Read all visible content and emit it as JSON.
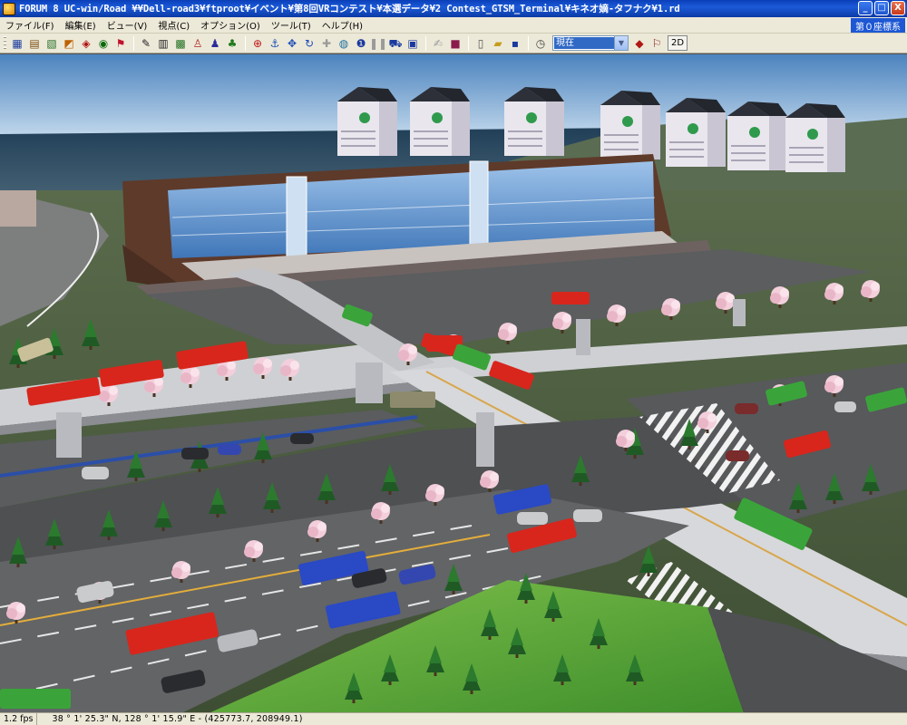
{
  "window": {
    "title": "FORUM 8   UC-win/Road   ¥¥Dell-road3¥ftproot¥イベント¥第8回VRコンテスト¥本選データ¥2 Contest_GTSM_Terminal¥キネオ嫡-タフナク¥1.rd",
    "minimize_label": "_",
    "maximize_label": "□",
    "close_label": "X"
  },
  "menu": {
    "items": [
      "ファイル(F)",
      "編集(E)",
      "ビュー(V)",
      "視点(C)",
      "オプション(O)",
      "ツール(T)",
      "ヘルプ(H)"
    ],
    "coordinate_system": "第０座標系"
  },
  "toolbar": {
    "groups": [
      [
        "toolbar-project-icon",
        "toolbar-road-icon",
        "toolbar-map-icon",
        "toolbar-vehicle-icon",
        "toolbar-sign-icon",
        "toolbar-traffic-icon",
        "toolbar-flag-icon"
      ],
      [
        "toolbar-pen-icon",
        "toolbar-grid-icon",
        "toolbar-model-icon",
        "toolbar-person-icon",
        "toolbar-walker-icon",
        "toolbar-tree-icon"
      ],
      [
        "toolbar-target-icon",
        "toolbar-anchor-icon",
        "toolbar-move-icon",
        "toolbar-rotate-icon",
        "toolbar-plus-icon",
        "toolbar-globe-icon",
        "toolbar-info-icon",
        "toolbar-pause-icon",
        "toolbar-car-icon",
        "toolbar-screen-icon"
      ],
      [
        "toolbar-edit-icon",
        "toolbar-book-icon"
      ],
      [
        "toolbar-new-file-icon",
        "toolbar-open-folder-icon",
        "toolbar-save-icon"
      ]
    ],
    "time_of_day": "現在",
    "view_2d_label": "2D"
  },
  "status": {
    "fps": "1.2 fps",
    "coordinates": "38 °  1' 25.3\" N, 128 °  1' 15.9\" E  -  (425773.7, 208949.1)"
  }
}
